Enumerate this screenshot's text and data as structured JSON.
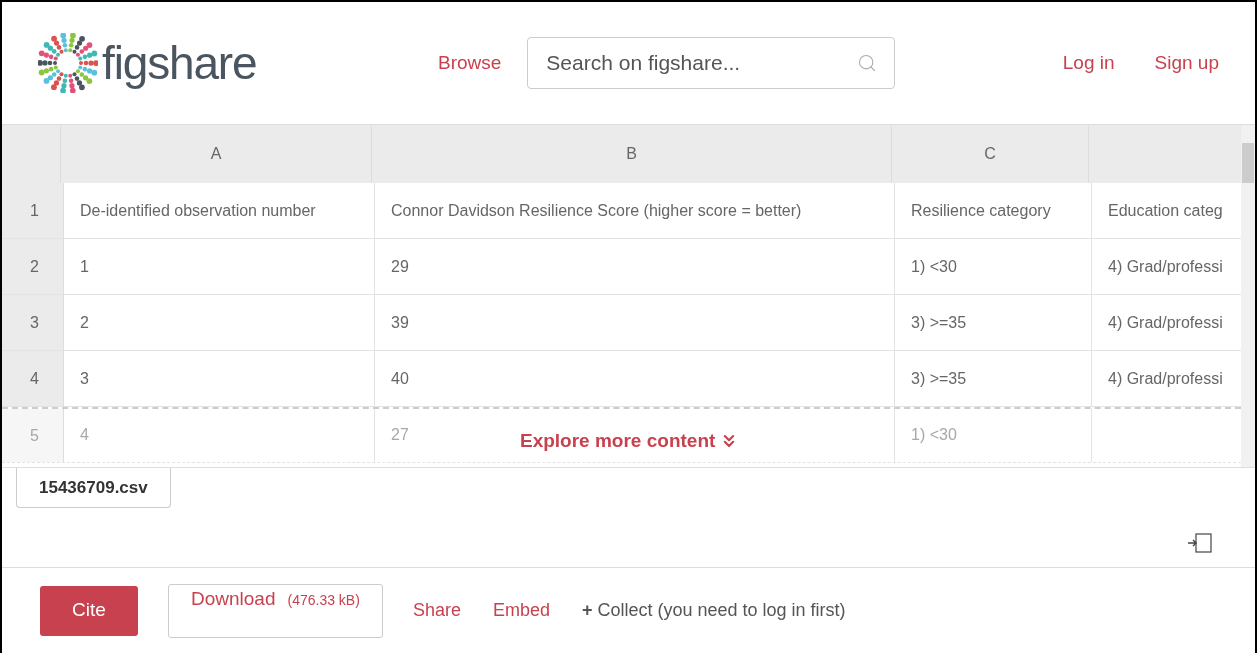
{
  "header": {
    "logo_text": "figshare",
    "nav": [
      {
        "label": "Browse"
      }
    ],
    "search": {
      "placeholder": "Search on figshare..."
    },
    "auth": [
      {
        "label": "Log in"
      },
      {
        "label": "Sign up"
      }
    ]
  },
  "sheet": {
    "columns": [
      "A",
      "B",
      "C"
    ],
    "rows": [
      {
        "num": "1",
        "cells": [
          "De-identified observation number",
          "Connor Davidson Resilience Score (higher score = better)",
          "Resilience category",
          "Education categ"
        ]
      },
      {
        "num": "2",
        "cells": [
          "1",
          "29",
          "1) <30",
          "4) Grad/professi"
        ]
      },
      {
        "num": "3",
        "cells": [
          "2",
          "39",
          "3) >=35",
          "4) Grad/professi"
        ]
      },
      {
        "num": "4",
        "cells": [
          "3",
          "40",
          "3) >=35",
          "4) Grad/professi"
        ]
      },
      {
        "num": "5",
        "faded": true,
        "cells": [
          "4",
          "27",
          "1) <30"
        ]
      }
    ],
    "explore": "Explore more content"
  },
  "file_tab": {
    "label": "15436709.csv",
    "selected": true
  },
  "actions": {
    "cite": "Cite",
    "download": "Download",
    "size": "(476.33 kB)",
    "links": [
      "Share",
      "Embed"
    ],
    "collect": "**+** Collect (you need to log in first)"
  }
}
